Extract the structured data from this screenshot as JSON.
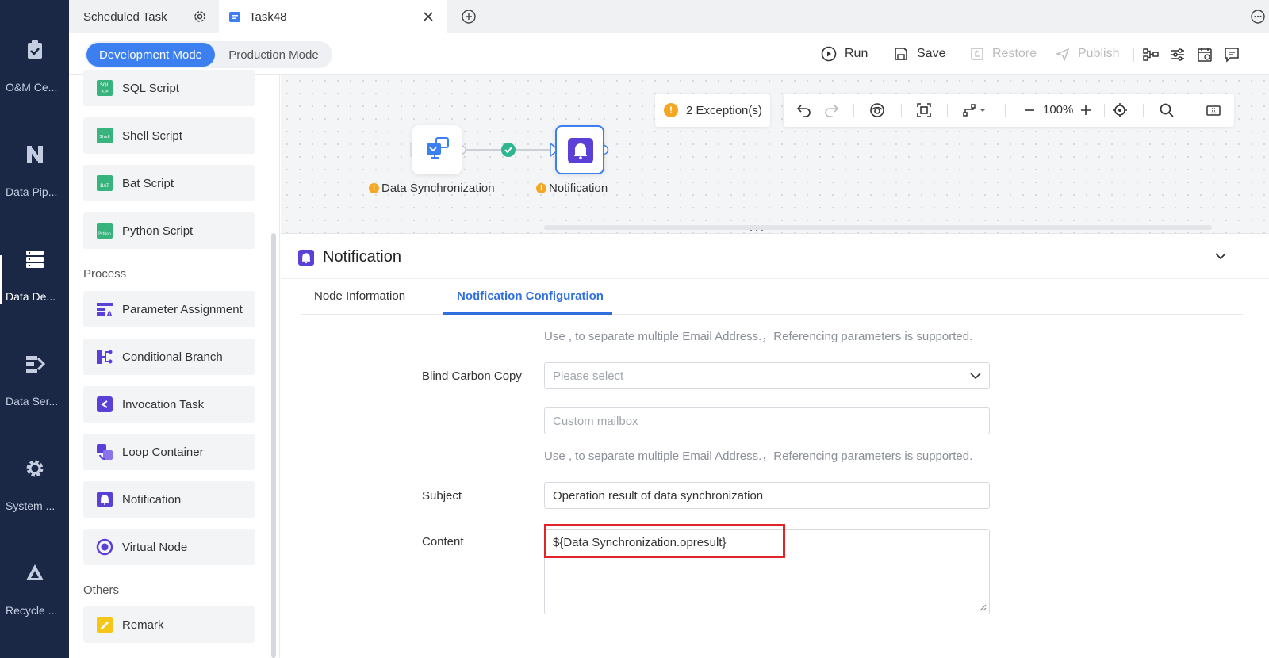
{
  "rail": {
    "items": [
      {
        "label": "O&M Ce...",
        "icon": "clipboard-check-icon"
      },
      {
        "label": "Data Pip...",
        "icon": "pipeline-icon"
      },
      {
        "label": "Data De...",
        "icon": "server-stack-icon"
      },
      {
        "label": "Data Ser...",
        "icon": "data-service-icon"
      },
      {
        "label": "System ...",
        "icon": "gear-icon"
      },
      {
        "label": "Recycle ...",
        "icon": "recycle-icon"
      }
    ]
  },
  "tabs": {
    "scheduled": "Scheduled Task",
    "current": "Task48"
  },
  "modes": {
    "development": "Development Mode",
    "production": "Production Mode"
  },
  "toolbar": {
    "run": "Run",
    "save": "Save",
    "restore": "Restore",
    "publish": "Publish"
  },
  "components": {
    "scripts": [
      {
        "label": "SQL Script",
        "icon": "sql-script-icon"
      },
      {
        "label": "Shell Script",
        "icon": "shell-script-icon"
      },
      {
        "label": "Bat Script",
        "icon": "bat-script-icon"
      },
      {
        "label": "Python Script",
        "icon": "python-script-icon"
      }
    ],
    "process_title": "Process",
    "process": [
      {
        "label": "Parameter Assignment",
        "icon": "parameter-icon"
      },
      {
        "label": "Conditional Branch",
        "icon": "branch-icon"
      },
      {
        "label": "Invocation Task",
        "icon": "invocation-icon"
      },
      {
        "label": "Loop Container",
        "icon": "loop-icon"
      },
      {
        "label": "Notification",
        "icon": "bell-icon"
      },
      {
        "label": "Virtual Node",
        "icon": "virtual-node-icon"
      }
    ],
    "others_title": "Others",
    "others": [
      {
        "label": "Remark",
        "icon": "remark-icon"
      }
    ]
  },
  "canvas": {
    "exceptions": "2 Exception(s)",
    "zoom": "100%",
    "nodes": [
      {
        "label": "Data Synchronization"
      },
      {
        "label": "Notification"
      }
    ]
  },
  "panel": {
    "title": "Notification",
    "tabs": [
      "Node Information",
      "Notification Configuration"
    ],
    "hint": "Use , to separate multiple Email Address.，Referencing parameters is supported.",
    "bcc_label": "Blind Carbon Copy",
    "bcc_placeholder": "Please select",
    "custom_placeholder": "Custom mailbox",
    "subject_label": "Subject",
    "subject_value": "Operation result of data synchronization",
    "content_label": "Content",
    "content_value": "${Data Synchronization.opresult}"
  },
  "colors": {
    "rail": "#1a2846",
    "accent": "#3b7ff0",
    "warning": "#f5a623",
    "success": "#2fb58f",
    "highlight": "#e0252a",
    "notify_purple": "#5b3fd6"
  }
}
